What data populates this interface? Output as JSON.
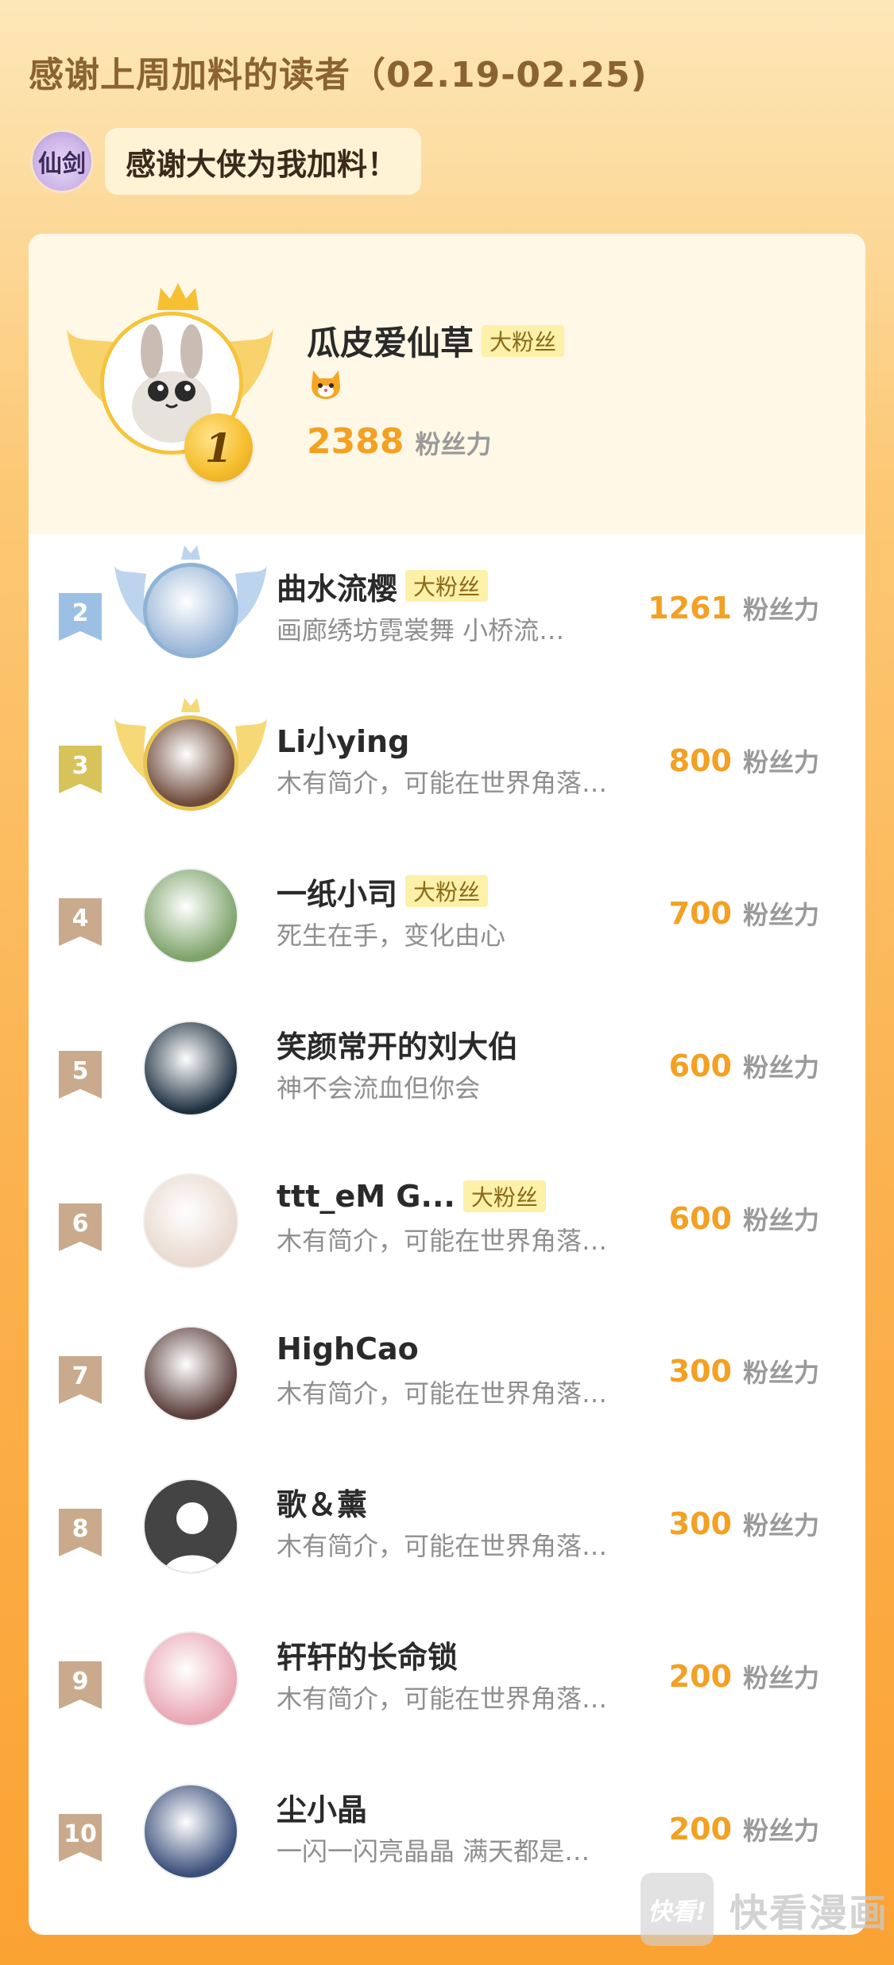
{
  "header": {
    "title": "感谢上周加料的读者（02.19-02.25)"
  },
  "thanks": {
    "avatar_text": "仙剑",
    "message": "感谢大侠为我加料！"
  },
  "top_fan": {
    "rank": "1",
    "name": "瓜皮爱仙草",
    "badge": "大粉丝",
    "icon": "cat-face-icon",
    "score": "2388",
    "unit": "粉丝力"
  },
  "fans": [
    {
      "rank": "2",
      "name": "曲水流樱",
      "badge": "大粉丝",
      "bio": "画廊绣坊霓裳舞 小桥流…",
      "score": "1261",
      "unit": "粉丝力",
      "tier": "silver",
      "avatar_color": "#9cb8d8"
    },
    {
      "rank": "3",
      "name": "Li小ying",
      "badge": "",
      "bio": "木有简介，可能在世界角落…",
      "score": "800",
      "unit": "粉丝力",
      "tier": "gold",
      "avatar_color": "#6e4a3a"
    },
    {
      "rank": "4",
      "name": "一纸小司",
      "badge": "大粉丝",
      "bio": "死生在手，变化由心",
      "score": "700",
      "unit": "粉丝力",
      "tier": "plain",
      "avatar_color": "#7da36a"
    },
    {
      "rank": "5",
      "name": "笑颜常开的刘大伯",
      "badge": "",
      "bio": "神不会流血但你会",
      "score": "600",
      "unit": "粉丝力",
      "tier": "plain",
      "avatar_color": "#1e3040"
    },
    {
      "rank": "6",
      "name": "ttt_eM G...",
      "badge": "大粉丝",
      "bio": "木有简介，可能在世界角落…",
      "score": "600",
      "unit": "粉丝力",
      "tier": "plain",
      "avatar_color": "#e9d9cf"
    },
    {
      "rank": "7",
      "name": "HighCao",
      "badge": "",
      "bio": "木有简介，可能在世界角落…",
      "score": "300",
      "unit": "粉丝力",
      "tier": "plain",
      "avatar_color": "#5a3e3a"
    },
    {
      "rank": "8",
      "name": "歌＆薰",
      "badge": "",
      "bio": "木有简介，可能在世界角落…",
      "score": "300",
      "unit": "粉丝力",
      "tier": "plain",
      "avatar_color": "#444444"
    },
    {
      "rank": "9",
      "name": "轩轩的长命锁",
      "badge": "",
      "bio": "木有简介，可能在世界角落…",
      "score": "200",
      "unit": "粉丝力",
      "tier": "plain",
      "avatar_color": "#e9a7b4"
    },
    {
      "rank": "10",
      "name": "尘小晶",
      "badge": "",
      "bio": "一闪一闪亮晶晶 满天都是…",
      "score": "200",
      "unit": "粉丝力",
      "tier": "plain",
      "avatar_color": "#3a4f7a"
    }
  ],
  "watermark": {
    "logo_text": "快看!",
    "text": "快看漫画"
  },
  "colors": {
    "accent": "#f3a023",
    "badge_bg": "#fdf0a8",
    "rank_silver": "#9cc0e4",
    "rank_gold": "#d8c25a",
    "rank_plain": "#c9aa8c"
  }
}
